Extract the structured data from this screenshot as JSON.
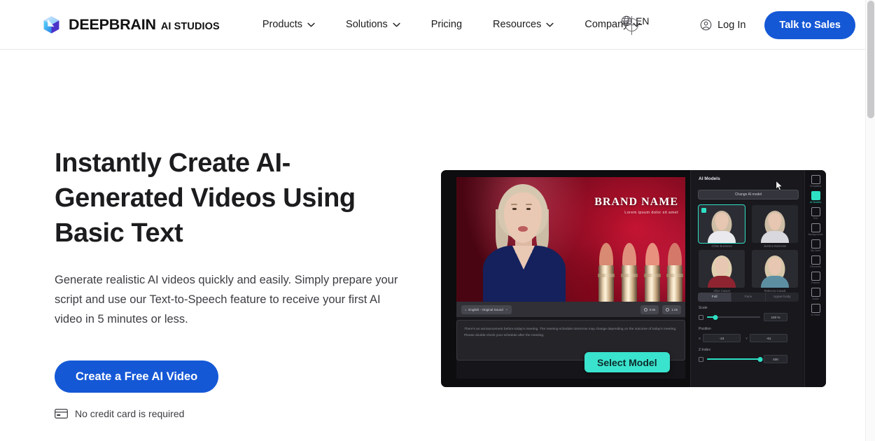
{
  "header": {
    "logo": {
      "icon": "cube-logo-icon",
      "main": "DEEPBRAIN",
      "sub": "AI STUDIOS"
    },
    "nav": [
      {
        "label": "Products",
        "has_dropdown": true
      },
      {
        "label": "Solutions",
        "has_dropdown": true
      },
      {
        "label": "Pricing",
        "has_dropdown": false
      },
      {
        "label": "Resources",
        "has_dropdown": true
      },
      {
        "label": "Company",
        "has_dropdown": true
      }
    ],
    "language": {
      "icon": "globe-icon",
      "label": "EN"
    },
    "login": {
      "icon": "user-circle-icon",
      "label": "Log In"
    },
    "cta": "Talk to Sales"
  },
  "hero": {
    "title": "Instantly Create AI-Generated Videos Using Basic Text",
    "subtitle": "Generate realistic AI videos quickly and easily. Simply prepare your script and use our Text-to-Speech feature to receive your first AI video in 5 minutes or less.",
    "cta": "Create a Free AI Video",
    "note": "No credit card is required",
    "note_icon": "credit-card-icon"
  },
  "app": {
    "video": {
      "brand_name": "BRAND NAME",
      "brand_tagline": "Lorem ipsum dolor sit amet",
      "lang_chip": "English - Original Sound",
      "duration_current": "0.0s",
      "duration_total": "1.0s",
      "script": "There's an announcement before today's meeting. The meeting schedule tomorrow may change depending on the outcome of today's meeting. Please double-check your schedule after the meeting."
    },
    "panel": {
      "title": "AI Models",
      "change_button": "Change AI model",
      "models": [
        {
          "label": "Chloe Business",
          "selected": true
        },
        {
          "label": "Jessica Business",
          "selected": false
        },
        {
          "label": "Alice Casual",
          "selected": false
        },
        {
          "label": "Rebecca Casual",
          "selected": false
        }
      ],
      "segments": [
        {
          "label": "Full",
          "active": true
        },
        {
          "label": "Face",
          "active": false
        },
        {
          "label": "Upper body",
          "active": false
        }
      ],
      "controls": [
        {
          "label": "Scale",
          "value": "100 %",
          "fill_pct": 16
        },
        {
          "label": "Z-Index",
          "value": "400",
          "fill_pct": 100
        }
      ],
      "position": {
        "label": "Position",
        "x_key": "X",
        "x_value": "-24",
        "y_key": "Y",
        "y_value": "-61"
      }
    },
    "rail": [
      {
        "label": "Templates",
        "icon": "templates-icon",
        "active": false
      },
      {
        "label": "AI Models",
        "icon": "ai-model-icon",
        "active": true
      },
      {
        "label": "Text",
        "icon": "text-icon",
        "active": false
      },
      {
        "label": "Backgrounds",
        "icon": "background-icon",
        "active": false
      },
      {
        "label": "My Vault",
        "icon": "vault-icon",
        "active": false
      },
      {
        "label": "Elements",
        "icon": "elements-icon",
        "active": false
      },
      {
        "label": "Frames",
        "icon": "frames-icon",
        "active": false
      },
      {
        "label": "Audio",
        "icon": "audio-icon",
        "active": false
      },
      {
        "label": "AI Voice",
        "icon": "ai-voice-icon",
        "active": false
      }
    ],
    "overlay_button": "Select Model"
  },
  "colors": {
    "brand_blue": "#1558d6",
    "accent_teal": "#3ae3cd",
    "panel_bg": "#18181d",
    "text_dark": "#1c1c1e"
  }
}
